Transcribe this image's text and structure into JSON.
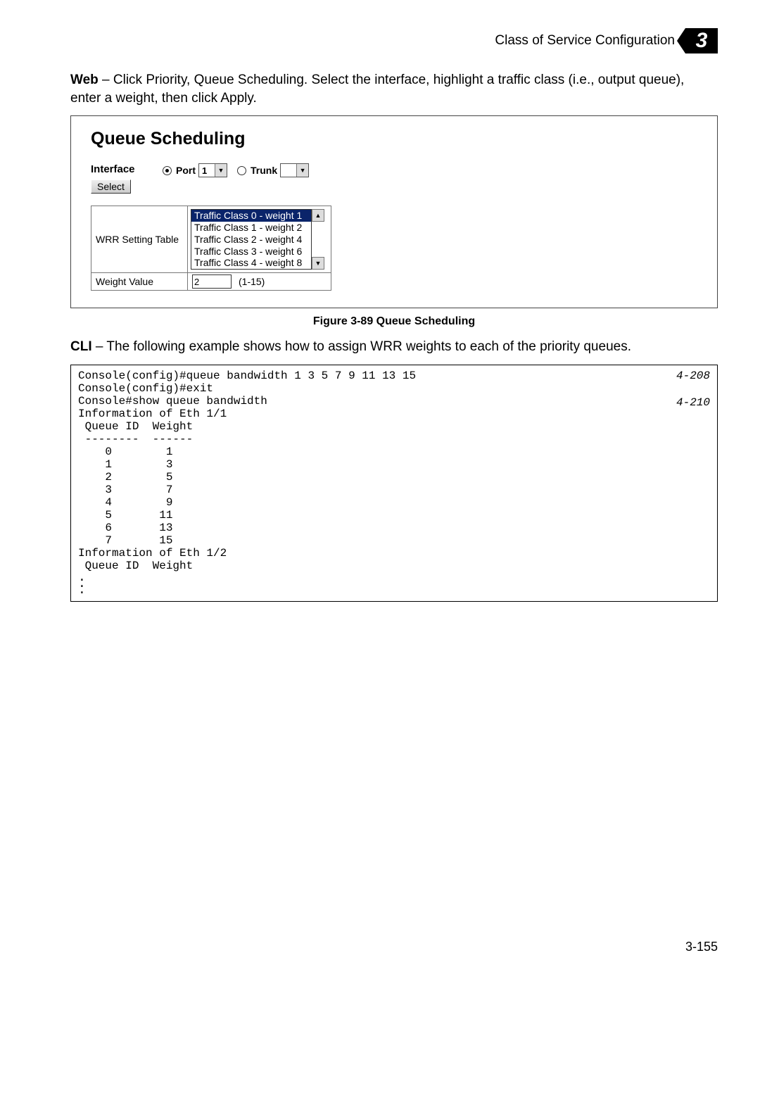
{
  "header": {
    "title": "Class of Service Configuration",
    "chapter": "3"
  },
  "web_para_bold": "Web",
  "web_para_rest": " – Click Priority, Queue Scheduling. Select the interface, highlight a traffic class (i.e., output queue), enter a weight, then click Apply.",
  "screenshot": {
    "title": "Queue Scheduling",
    "interface_label": "Interface",
    "select_btn": "Select",
    "port_label": "Port",
    "port_value": "1",
    "trunk_label": "Trunk",
    "trunk_value": "",
    "wrr_label": "WRR Setting Table",
    "wrr_options": [
      "Traffic Class 0 - weight 1",
      "Traffic Class 1 - weight 2",
      "Traffic Class 2 - weight 4",
      "Traffic Class 3 - weight 6",
      "Traffic Class 4 - weight 8"
    ],
    "weight_label": "Weight Value",
    "weight_value": "2",
    "weight_hint": "(1-15)"
  },
  "figure_caption": "Figure 3-89   Queue Scheduling",
  "cli_para_bold": "CLI",
  "cli_para_rest": " – The following example shows how to assign WRR weights to each of the priority queues.",
  "cli": {
    "line1": "Console(config)#queue bandwidth 1 3 5 7 9 11 13 15",
    "ref1": "4-208",
    "line2": "Console(config)#exit",
    "line3": "Console#show queue bandwidth",
    "ref2": "4-210",
    "body": "Information of Eth 1/1\n Queue ID  Weight\n --------  ------\n    0        1\n    1        3\n    2        5\n    3        7\n    4        9\n    5       11\n    6       13\n    7       15\nInformation of Eth 1/2\n Queue ID  Weight"
  },
  "page_number": "3-155"
}
